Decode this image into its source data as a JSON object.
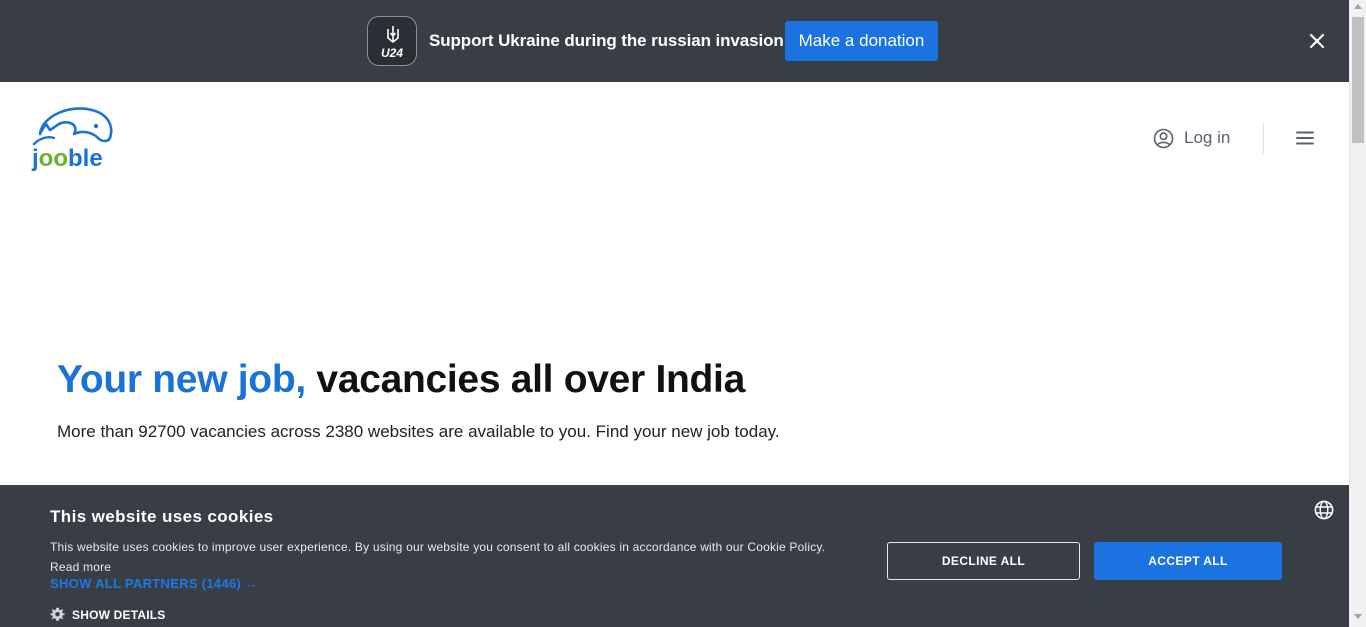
{
  "banner": {
    "badge_text": "U24",
    "message": "Support Ukraine during the russian invasion",
    "donate_label": "Make a donation"
  },
  "header": {
    "logo_text": "jooble",
    "login_label": "Log in"
  },
  "hero": {
    "title_highlight": "Your new job,",
    "title_rest": " vacancies all over India",
    "subtitle": "More than 92700 vacancies across 2380 websites are available to you. Find your new job today."
  },
  "cookie": {
    "title": "This website uses cookies",
    "body": "This website uses cookies to improve user experience. By using our website you consent to all cookies in accordance with our Cookie Policy. Read more",
    "partners_link": "SHOW ALL PARTNERS (1446) →",
    "details_label": "SHOW DETAILS",
    "decline_label": "DECLINE ALL",
    "accept_label": "ACCEPT ALL"
  },
  "colors": {
    "banner_bg": "#393e46",
    "accent_blue": "#1a73e0",
    "logo_green": "#65b32e",
    "cookie_bg": "#393d45"
  }
}
